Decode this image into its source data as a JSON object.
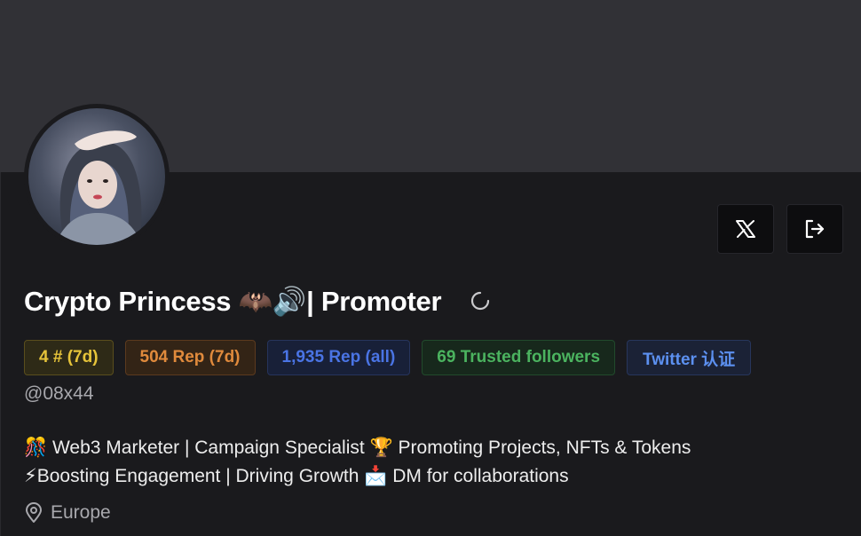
{
  "profile": {
    "display_name": "Crypto Princess 🦇🔊| Promoter",
    "handle": "@08x44",
    "bio_line1": "🎊 Web3 Marketer | Campaign Specialist 🏆 Promoting Projects, NFTs & Tokens",
    "bio_line2": "⚡Boosting Engagement | Driving Growth 📩 DM for collaborations",
    "location": "Europe"
  },
  "badges": [
    {
      "label": "4 # (7d)",
      "color": "#e6c43a"
    },
    {
      "label": "504 Rep (7d)",
      "color": "#e08a3c"
    },
    {
      "label": "1,935 Rep (all)",
      "color": "#4a74e4"
    },
    {
      "label": "69 Trusted followers",
      "color": "#4bb35f"
    },
    {
      "label": "Twitter 认证",
      "color": "#5c90f0"
    }
  ],
  "actions": {
    "x_icon": "x-logo-icon",
    "logout_icon": "logout-icon"
  },
  "icons": {
    "loading": "spinner-icon",
    "location": "map-pin-icon"
  },
  "colors": {
    "background": "#1a1a1d",
    "banner": "#313136"
  }
}
